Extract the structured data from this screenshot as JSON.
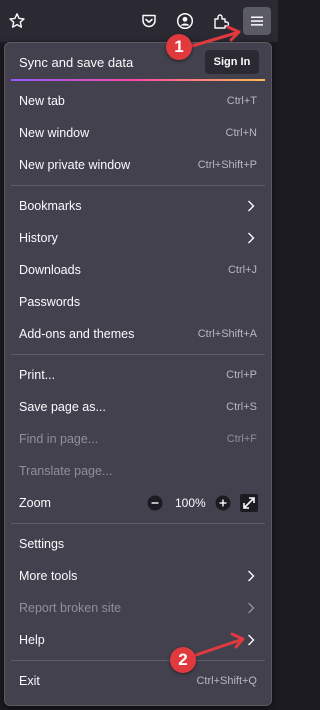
{
  "toolbar": {
    "icons": [
      "star-icon",
      "pocket-icon",
      "account-icon",
      "extensions-icon",
      "hamburger-menu-icon"
    ]
  },
  "sync": {
    "label": "Sync and save data",
    "sign_in": "Sign In"
  },
  "menu": {
    "new_tab": {
      "label": "New tab",
      "shortcut": "Ctrl+T"
    },
    "new_window": {
      "label": "New window",
      "shortcut": "Ctrl+N"
    },
    "new_private_window": {
      "label": "New private window",
      "shortcut": "Ctrl+Shift+P"
    },
    "bookmarks": {
      "label": "Bookmarks"
    },
    "history": {
      "label": "History"
    },
    "downloads": {
      "label": "Downloads",
      "shortcut": "Ctrl+J"
    },
    "passwords": {
      "label": "Passwords"
    },
    "addons": {
      "label": "Add-ons and themes",
      "shortcut": "Ctrl+Shift+A"
    },
    "print": {
      "label": "Print...",
      "shortcut": "Ctrl+P"
    },
    "save_page": {
      "label": "Save page as...",
      "shortcut": "Ctrl+S"
    },
    "find_in_page": {
      "label": "Find in page...",
      "shortcut": "Ctrl+F"
    },
    "translate_page": {
      "label": "Translate page..."
    },
    "zoom": {
      "label": "Zoom",
      "level": "100%"
    },
    "settings": {
      "label": "Settings"
    },
    "more_tools": {
      "label": "More tools"
    },
    "report_broken_site": {
      "label": "Report broken site"
    },
    "help": {
      "label": "Help"
    },
    "exit": {
      "label": "Exit",
      "shortcut": "Ctrl+Shift+Q"
    }
  },
  "callouts": {
    "first": "1",
    "second": "2"
  },
  "colors": {
    "panel": "#42414d",
    "toolbar": "#2b2a33",
    "callout": "#e0393e",
    "text": "#fbfbfe",
    "disabled": "#8f8f9d"
  }
}
